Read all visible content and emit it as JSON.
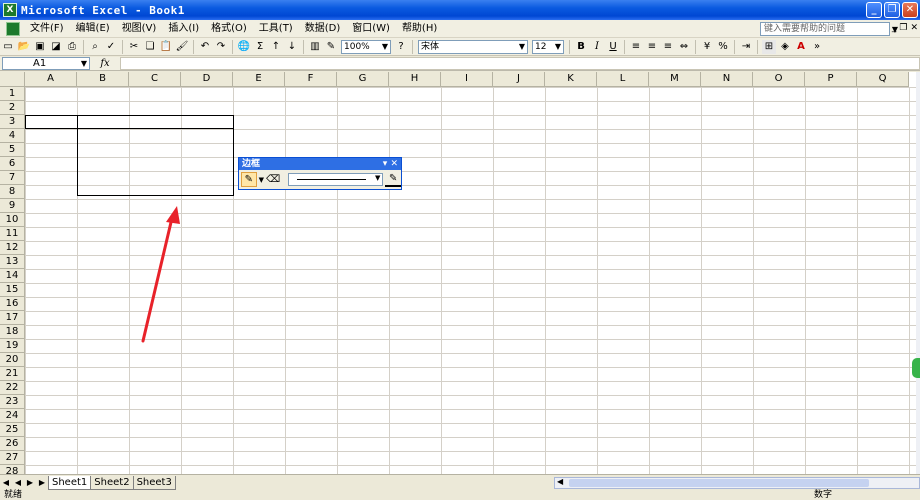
{
  "window": {
    "title": "Microsoft Excel - Book1",
    "app_icon": "excel-icon"
  },
  "menu": {
    "items": [
      "文件(F)",
      "编辑(E)",
      "视图(V)",
      "插入(I)",
      "格式(O)",
      "工具(T)",
      "数据(D)",
      "窗口(W)",
      "帮助(H)"
    ],
    "help_placeholder": "键入需要帮助的问题"
  },
  "toolbar": {
    "zoom": "100%",
    "font_name": "宋体",
    "font_size": "12",
    "bold_label": "B",
    "italic_label": "I",
    "underline_label": "U",
    "percent_label": "%"
  },
  "formula_bar": {
    "name_box": "A1",
    "fx_label": "fx"
  },
  "sheet": {
    "columns": [
      "A",
      "B",
      "C",
      "D",
      "E",
      "F",
      "G",
      "H",
      "I",
      "J",
      "K",
      "L",
      "M",
      "N",
      "O",
      "P",
      "Q"
    ],
    "rows": [
      "1",
      "2",
      "3",
      "4",
      "5",
      "6",
      "7",
      "8",
      "9",
      "10",
      "11",
      "12",
      "13",
      "14",
      "15",
      "16",
      "17",
      "18",
      "19",
      "20",
      "21",
      "22",
      "23",
      "24",
      "25",
      "26",
      "27",
      "28"
    ]
  },
  "borders_toolbar": {
    "title": "边框"
  },
  "tabs": [
    "Sheet1",
    "Sheet2",
    "Sheet3"
  ],
  "active_tab": "Sheet1",
  "status": {
    "left": "就绪",
    "right": "数字"
  },
  "colors": {
    "title_bar": "#0a5ae0",
    "annotation_arrow": "#e8222a",
    "cell_border": "#000000"
  }
}
